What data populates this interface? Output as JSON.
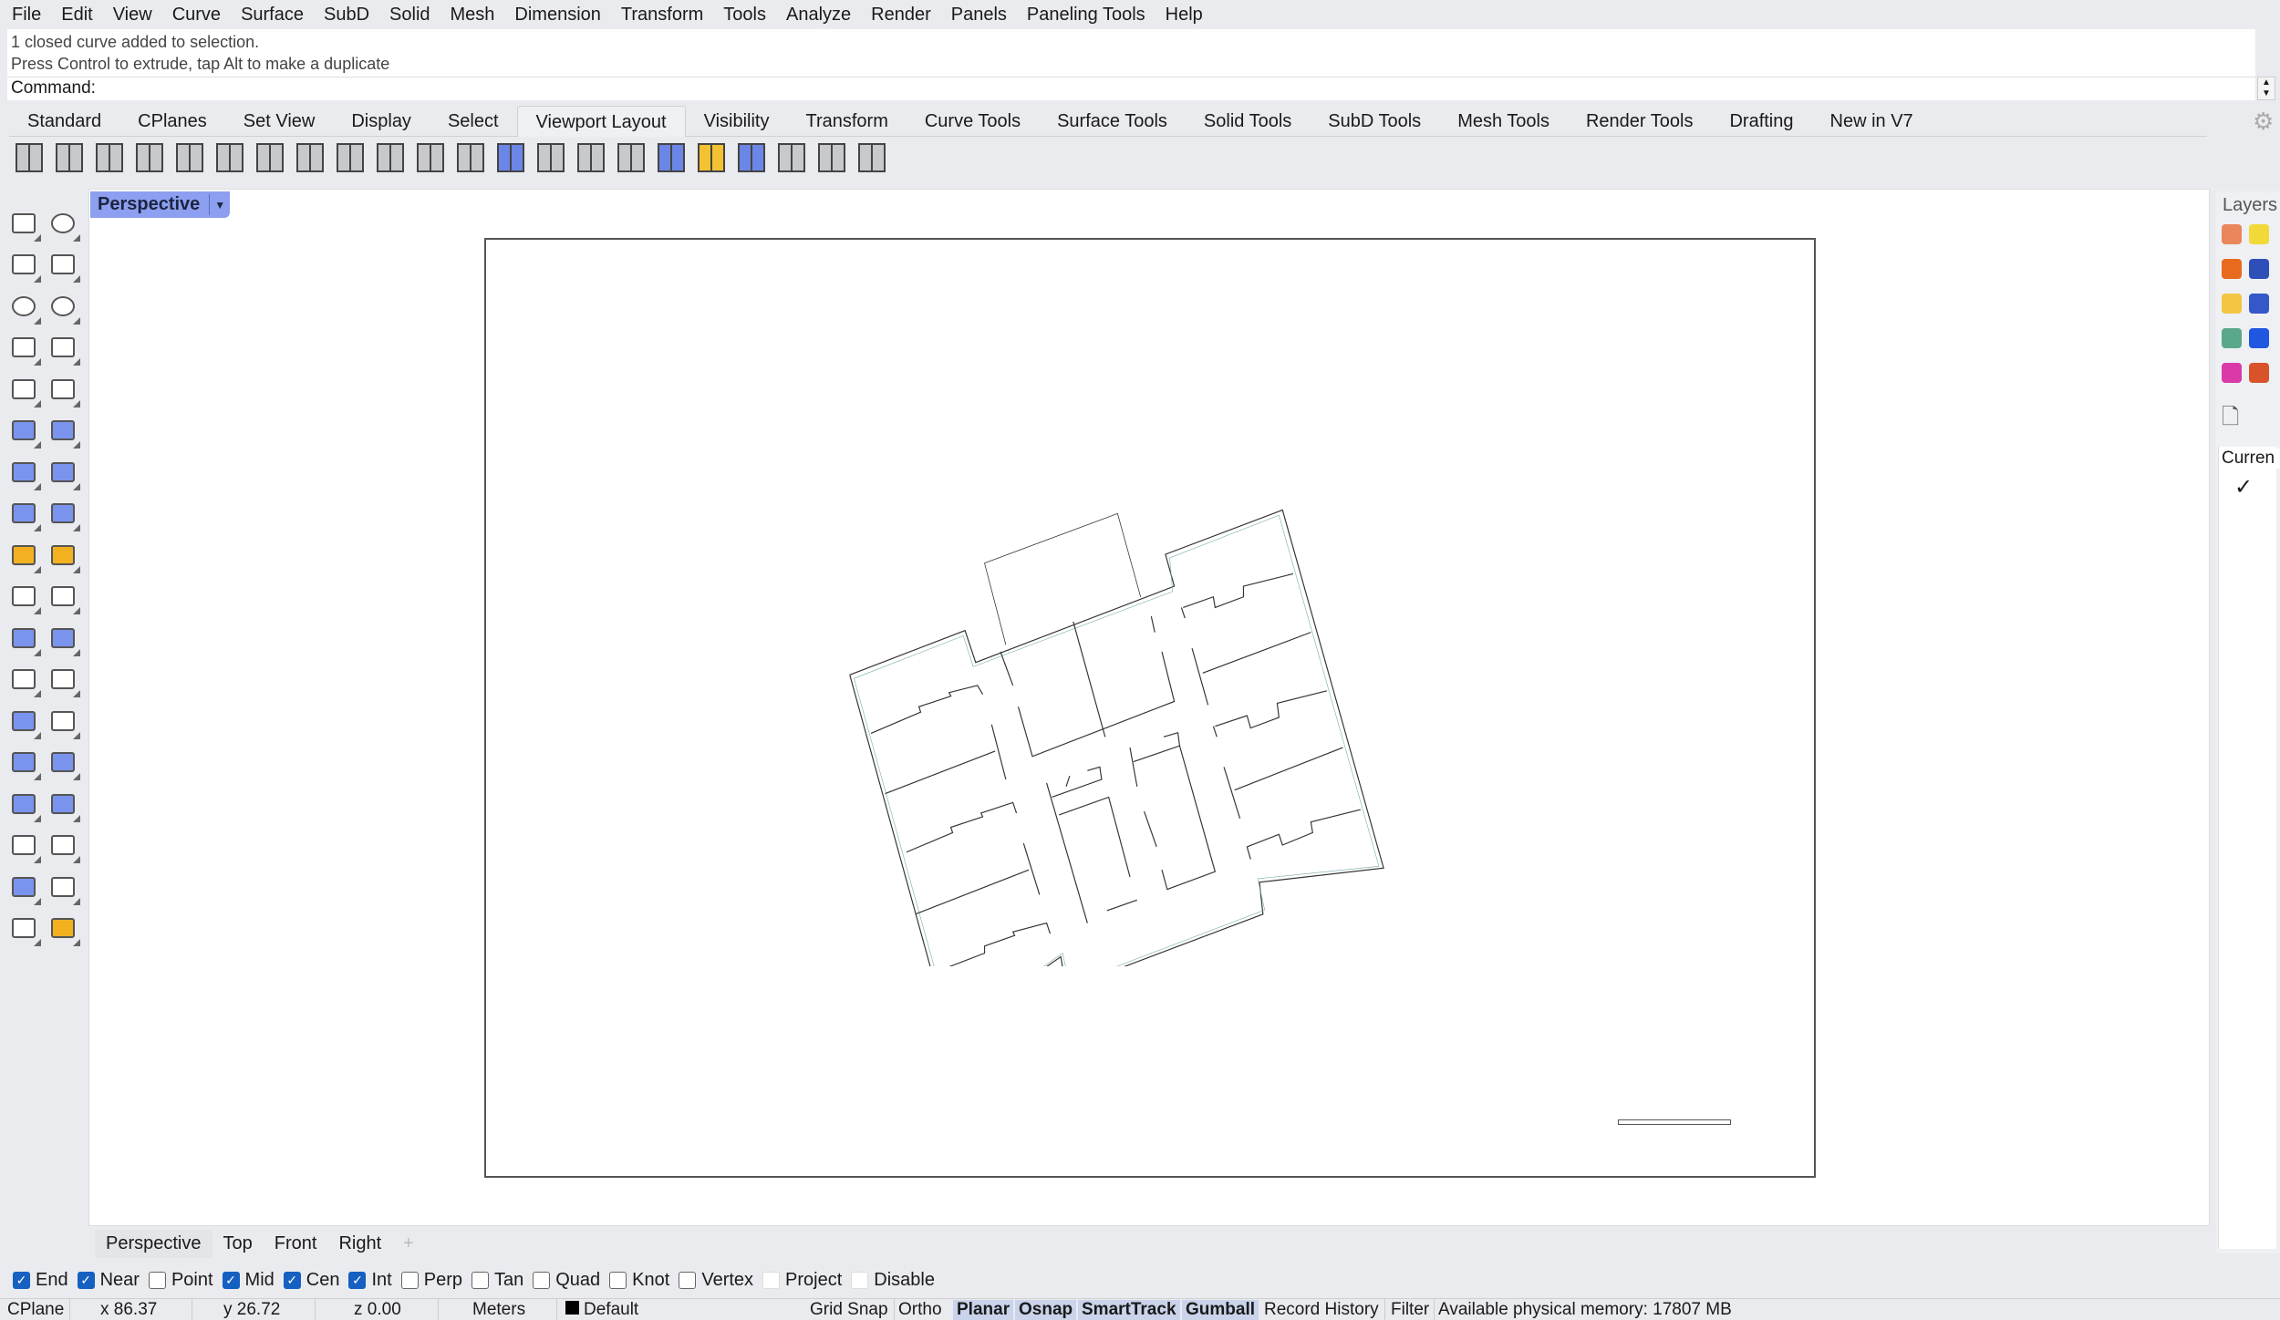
{
  "menu": [
    "File",
    "Edit",
    "View",
    "Curve",
    "Surface",
    "SubD",
    "Solid",
    "Mesh",
    "Dimension",
    "Transform",
    "Tools",
    "Analyze",
    "Render",
    "Panels",
    "Paneling Tools",
    "Help"
  ],
  "command": {
    "history": [
      "1 closed curve added to selection.",
      "Press Control to extrude, tap Alt to make a duplicate"
    ],
    "prompt": "Command:"
  },
  "ribbon_tabs": [
    "Standard",
    "CPlanes",
    "Set View",
    "Display",
    "Select",
    "Viewport Layout",
    "Visibility",
    "Transform",
    "Curve Tools",
    "Surface Tools",
    "Solid Tools",
    "SubD Tools",
    "Mesh Tools",
    "Render Tools",
    "Drafting",
    "New in V7"
  ],
  "active_ribbon_tab": "Viewport Layout",
  "toolbar_icons": [
    "split-horizontal-icon",
    "four-viewports-icon",
    "single-viewport-icon",
    "new-viewport-icon",
    "floating-viewport-icon",
    "split-viewport-horizontal-icon",
    "split-viewport-vertical-icon",
    "viewport-grid-icon",
    "sphere-view-icon",
    "two-sphere-view-icon",
    "grid-icon",
    "lens-icon",
    "color-palette-icon",
    "layout-page-icon",
    "detail-view-icon",
    "width-dimension-icon",
    "water-level-icon",
    "folder-open-icon",
    "camera-target-icon",
    "print-icon",
    "layout-number-icon",
    "lock-icon"
  ],
  "viewport": {
    "name": "Perspective",
    "dropdown_icon": "triangle-down-icon"
  },
  "left_toolbar": [
    {
      "icon": "select-arrow-icon",
      "c": "w"
    },
    {
      "icon": "point-icon",
      "c": "o"
    },
    {
      "icon": "polyline-icon",
      "c": "w"
    },
    {
      "icon": "curve-icon",
      "c": "w"
    },
    {
      "icon": "circle-icon",
      "c": "o"
    },
    {
      "icon": "ellipse-icon",
      "c": "o"
    },
    {
      "icon": "arc-icon",
      "c": "w"
    },
    {
      "icon": "rectangle-icon",
      "c": "w"
    },
    {
      "icon": "polygon-icon",
      "c": "w"
    },
    {
      "icon": "fillet-curve-icon",
      "c": "w"
    },
    {
      "icon": "surface-from-points-icon",
      "c": "b"
    },
    {
      "icon": "extrude-surface-icon",
      "c": "b"
    },
    {
      "icon": "box-icon",
      "c": "b"
    },
    {
      "icon": "boolean-spheres-icon",
      "c": "b"
    },
    {
      "icon": "cylinder-icon",
      "c": "b"
    },
    {
      "icon": "mesh-plane-icon",
      "c": "b"
    },
    {
      "icon": "join-puzzle-icon",
      "c": "y"
    },
    {
      "icon": "explode-icon",
      "c": "y"
    },
    {
      "icon": "trim-icon",
      "c": "w"
    },
    {
      "icon": "split-icon",
      "c": "w"
    },
    {
      "icon": "boolean-union-icon",
      "c": "b"
    },
    {
      "icon": "group-icon",
      "c": "b"
    },
    {
      "icon": "fillet-icon",
      "c": "w"
    },
    {
      "icon": "offset-curve-icon",
      "c": "w"
    },
    {
      "icon": "text-icon",
      "c": "b"
    },
    {
      "icon": "move-icon",
      "c": "w"
    },
    {
      "icon": "copy-icon",
      "c": "b"
    },
    {
      "icon": "orient-icon",
      "c": "b"
    },
    {
      "icon": "solid-edit-icon",
      "c": "b"
    },
    {
      "icon": "project-to-plane-icon",
      "c": "b"
    },
    {
      "icon": "array-icon",
      "c": "w"
    },
    {
      "icon": "align-icon",
      "c": "w"
    },
    {
      "icon": "analyze-icon",
      "c": "b"
    },
    {
      "icon": "checkmark-icon",
      "c": "w"
    },
    {
      "icon": "render-shapes-icon",
      "c": "w"
    },
    {
      "icon": "drafting-pyramid-icon",
      "c": "y"
    }
  ],
  "right_panel": {
    "title": "Layers",
    "icons": [
      {
        "icon": "brush-icon",
        "color": "#e9865a"
      },
      {
        "icon": "lightbulb-icon",
        "color": "#f2d93a"
      },
      {
        "icon": "sun-icon",
        "color": "#e86a1e"
      },
      {
        "icon": "material-sphere-icon",
        "color": "#2f4fb8"
      },
      {
        "icon": "folder-icon",
        "color": "#f3c542"
      },
      {
        "icon": "help-icon",
        "color": "#3558c8"
      },
      {
        "icon": "environment-icon",
        "color": "#5aa88a"
      },
      {
        "icon": "notification-bell-icon",
        "color": "#1f57e0"
      },
      {
        "icon": "color-wheel-icon",
        "color": "#d93aa8"
      },
      {
        "icon": "named-views-icon",
        "color": "#d9532a"
      }
    ],
    "column_label": "Curren",
    "current_check": "✓"
  },
  "viewport_tabs": [
    "Perspective",
    "Top",
    "Front",
    "Right"
  ],
  "add_tab": "+",
  "osnap": [
    {
      "label": "End",
      "checked": true
    },
    {
      "label": "Near",
      "checked": true
    },
    {
      "label": "Point",
      "checked": false
    },
    {
      "label": "Mid",
      "checked": true
    },
    {
      "label": "Cen",
      "checked": true
    },
    {
      "label": "Int",
      "checked": true
    },
    {
      "label": "Perp",
      "checked": false
    },
    {
      "label": "Tan",
      "checked": false
    },
    {
      "label": "Quad",
      "checked": false
    },
    {
      "label": "Knot",
      "checked": false
    },
    {
      "label": "Vertex",
      "checked": false
    },
    {
      "label": "Project",
      "checked": false,
      "disabled": true
    },
    {
      "label": "Disable",
      "checked": false,
      "disabled": true
    }
  ],
  "status": {
    "cplane": "CPlane",
    "x": "x 86.37",
    "y": "y 26.72",
    "z": "z 0.00",
    "units": "Meters",
    "layer": "Default",
    "layer_color": "#000000",
    "grid_snap": "Grid Snap",
    "ortho": "Ortho",
    "planar": "Planar",
    "osnap": "Osnap",
    "smarttrack": "SmartTrack",
    "gumball": "Gumball",
    "record_history": "Record History",
    "filter": "Filter",
    "memory": "Available physical memory: 17807 MB"
  },
  "colors": {
    "viewport_tab": "#8c9ff0",
    "checkbox": "#1560c0",
    "status_highlight": "#c9d3ea"
  }
}
